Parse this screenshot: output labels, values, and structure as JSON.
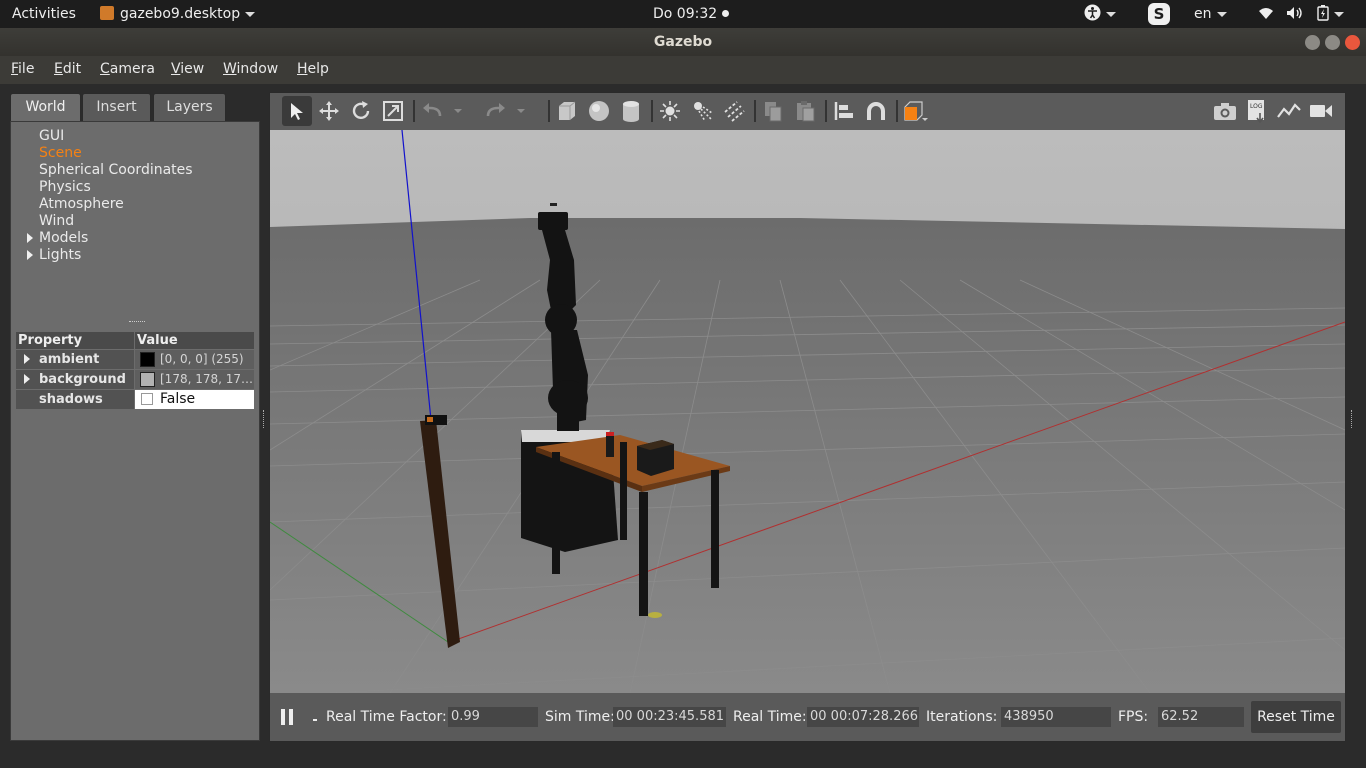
{
  "topbar": {
    "activities": "Activities",
    "app_name": "gazebo9.desktop",
    "clock": "Do 09:32",
    "skype_letter": "S",
    "language": "en"
  },
  "window": {
    "title": "Gazebo"
  },
  "menu": [
    "File",
    "Edit",
    "Camera",
    "View",
    "Window",
    "Help"
  ],
  "left_panel": {
    "tabs": [
      "World",
      "Insert",
      "Layers"
    ],
    "tree": [
      "GUI",
      "Scene",
      "Spherical Coordinates",
      "Physics",
      "Atmosphere",
      "Wind",
      "Models",
      "Lights"
    ],
    "selected": "Scene",
    "property_header": "Property",
    "value_header": "Value",
    "properties": [
      {
        "name": "ambient",
        "value": "[0, 0, 0] (255)",
        "color": "#000000"
      },
      {
        "name": "background",
        "value": "[178, 178, 17…",
        "color": "#b2b2b2"
      },
      {
        "name": "shadows",
        "value": "False"
      }
    ]
  },
  "toolbar_icons": [
    "select-arrow-icon",
    "translate-icon",
    "rotate-icon",
    "scale-icon",
    "undo-icon",
    "redo-icon",
    "box-icon",
    "sphere-icon",
    "cylinder-icon",
    "point-light-icon",
    "spot-light-icon",
    "directional-light-icon",
    "copy-icon",
    "paste-icon",
    "align-icon",
    "snap-icon",
    "view-angle-icon",
    "screenshot-icon",
    "log-icon",
    "plot-icon",
    "record-icon"
  ],
  "status": {
    "rtf_label": "Real Time Factor:",
    "rtf_value": "0.99",
    "sim_label": "Sim Time:",
    "sim_value": "00 00:23:45.581",
    "real_label": "Real Time:",
    "real_value": "00 00:07:28.266",
    "iter_label": "Iterations:",
    "iter_value": "438950",
    "fps_label": "FPS:",
    "fps_value": "62.52",
    "reset_label": "Reset Time"
  },
  "colors": {
    "accent": "#f58113",
    "sky": "#b2b2b2",
    "ground": "#7a7a7a"
  }
}
